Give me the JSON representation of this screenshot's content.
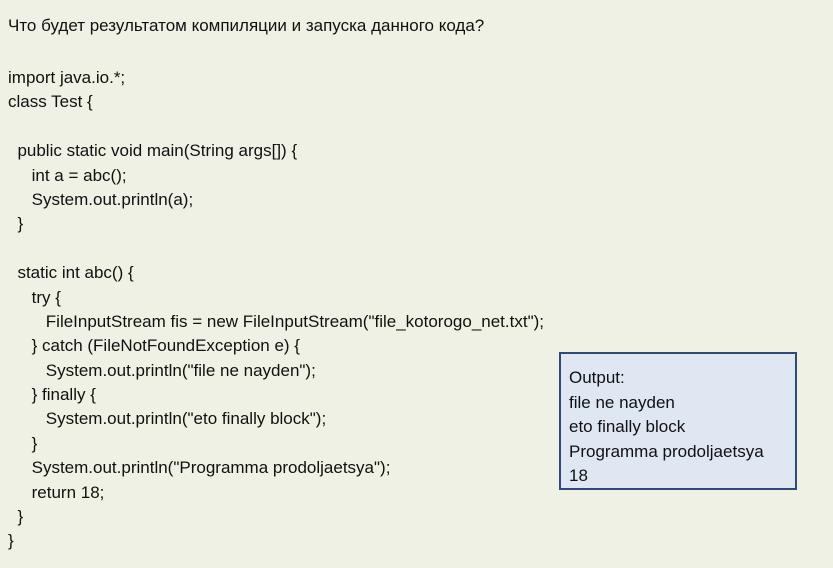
{
  "question": "Что будет результатом компиляции и запуска данного кода?",
  "code_lines": [
    "import java.io.*;",
    "class Test {",
    "",
    "  public static void main(String args[]) {",
    "     int a = abc();",
    "     System.out.println(a);",
    "  }",
    "",
    "  static int abc() {",
    "     try {",
    "        FileInputStream fis = new FileInputStream(\"file_kotorogo_net.txt\");",
    "     } catch (FileNotFoundException e) {",
    "        System.out.println(\"file ne nayden\");",
    "     } finally {",
    "        System.out.println(\"eto finally block\");",
    "     }",
    "     System.out.println(\"Programma prodoljaetsya\");",
    "     return 18;",
    "  }",
    "}"
  ],
  "output": {
    "title": "Output:",
    "lines": [
      "file ne nayden",
      "eto finally block",
      "Programma prodoljaetsya",
      "18"
    ]
  },
  "colors": {
    "background": "#eef1e4",
    "output_background": "#dfe7f3",
    "output_border": "#2f4a76",
    "text": "#111111"
  }
}
